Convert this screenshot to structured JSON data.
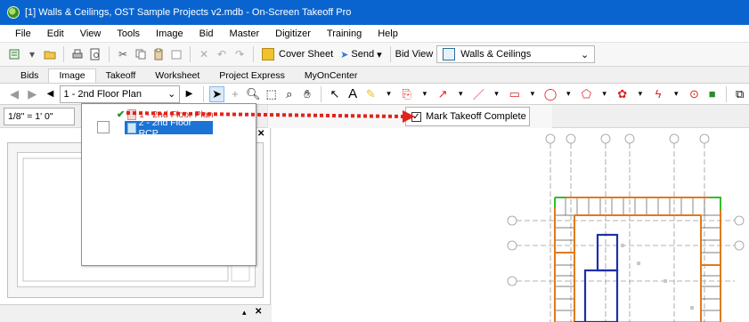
{
  "window": {
    "title": "[1] Walls & Ceilings, OST Sample Projects v2.mdb - On-Screen Takeoff Pro"
  },
  "menu": [
    "File",
    "Edit",
    "View",
    "Tools",
    "Image",
    "Bid",
    "Master",
    "Digitizer",
    "Training",
    "Help"
  ],
  "toolbar": {
    "cover_sheet_label": "Cover Sheet",
    "send_label": "Send",
    "bid_view_label": "Bid View",
    "bid_view_value": "Walls & Ceilings"
  },
  "tabs": [
    "Bids",
    "Image",
    "Takeoff",
    "Worksheet",
    "Project Express",
    "MyOnCenter"
  ],
  "image_toolbar": {
    "page_select_value": "1 - 2nd Floor Plan",
    "text_tool_label": "A"
  },
  "scale": {
    "value": "1/8\" = 1' 0\""
  },
  "page_dropdown": {
    "items": [
      {
        "label": "1 - 2nd Floor Plan",
        "takeoff_complete": true
      },
      {
        "label": "2 - 2nd Floor RCP",
        "takeoff_complete": false
      }
    ]
  },
  "mark_takeoff": {
    "label": "Mark Takeoff Complete",
    "checked": true
  },
  "colors": {
    "titlebar": "#0a64cf",
    "arrow": "#e0241c",
    "selection": "#1b73d6",
    "complete_check": "#1f8f28"
  }
}
